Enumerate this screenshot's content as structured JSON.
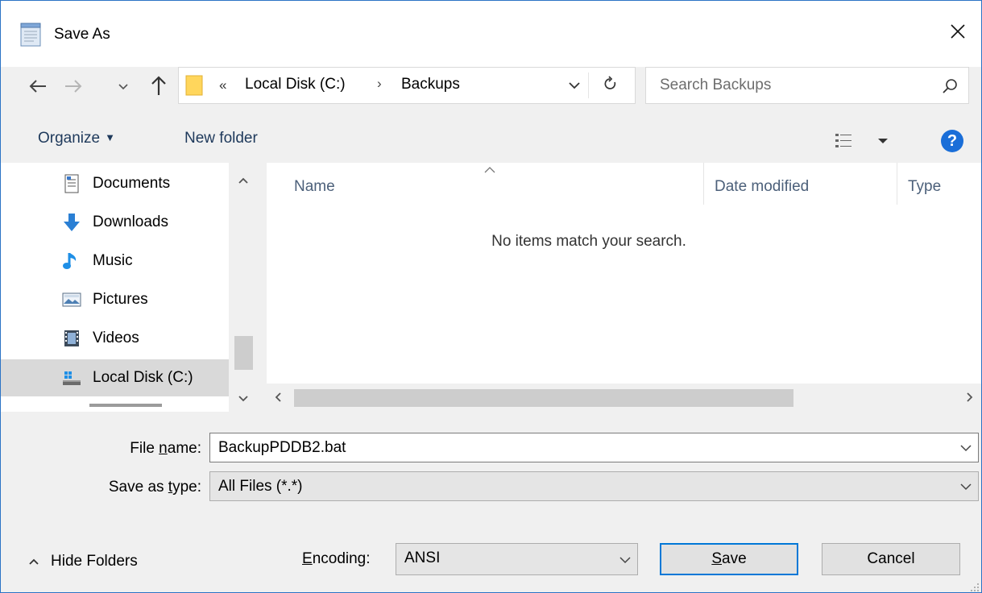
{
  "window": {
    "title": "Save As",
    "close_glyph": "✕",
    "title_icon": "notepad-icon"
  },
  "address": {
    "overflow_glyph": "«",
    "segments": [
      "Local Disk (C:)",
      "Backups"
    ],
    "separator": "›"
  },
  "search": {
    "placeholder": "Search Backups"
  },
  "toolbar": {
    "organize_label": "Organize",
    "organize_caret": "▼",
    "new_folder_label": "New folder",
    "help_label": "?"
  },
  "nav_pane": {
    "items": [
      {
        "label": "Documents",
        "icon": "documents-icon"
      },
      {
        "label": "Downloads",
        "icon": "downloads-icon"
      },
      {
        "label": "Music",
        "icon": "music-icon"
      },
      {
        "label": "Pictures",
        "icon": "pictures-icon"
      },
      {
        "label": "Videos",
        "icon": "videos-icon"
      },
      {
        "label": "Local Disk (C:)",
        "icon": "local-disk-icon",
        "selected": true
      }
    ]
  },
  "file_list": {
    "columns": [
      "Name",
      "Date modified",
      "Type"
    ],
    "empty_message": "No items match your search."
  },
  "form": {
    "file_name_label_pre": "File ",
    "file_name_label_u": "n",
    "file_name_label_post": "ame:",
    "file_name_value": "BackupPDDB2.bat",
    "save_type_label_pre": "Save as ",
    "save_type_label_u": "t",
    "save_type_label_post": "ype:",
    "save_type_value": "All Files  (*.*)",
    "encoding_label_u": "E",
    "encoding_label_post": "ncoding:",
    "encoding_value": "ANSI"
  },
  "footer": {
    "hide_folders_label": "Hide Folders",
    "save_label_u": "S",
    "save_label_post": "ave",
    "cancel_label": "Cancel"
  },
  "colors": {
    "accent": "#0078d7",
    "help": "#1a6ed8",
    "selected_row": "#d9d9d9",
    "header_text": "#4c607a"
  }
}
